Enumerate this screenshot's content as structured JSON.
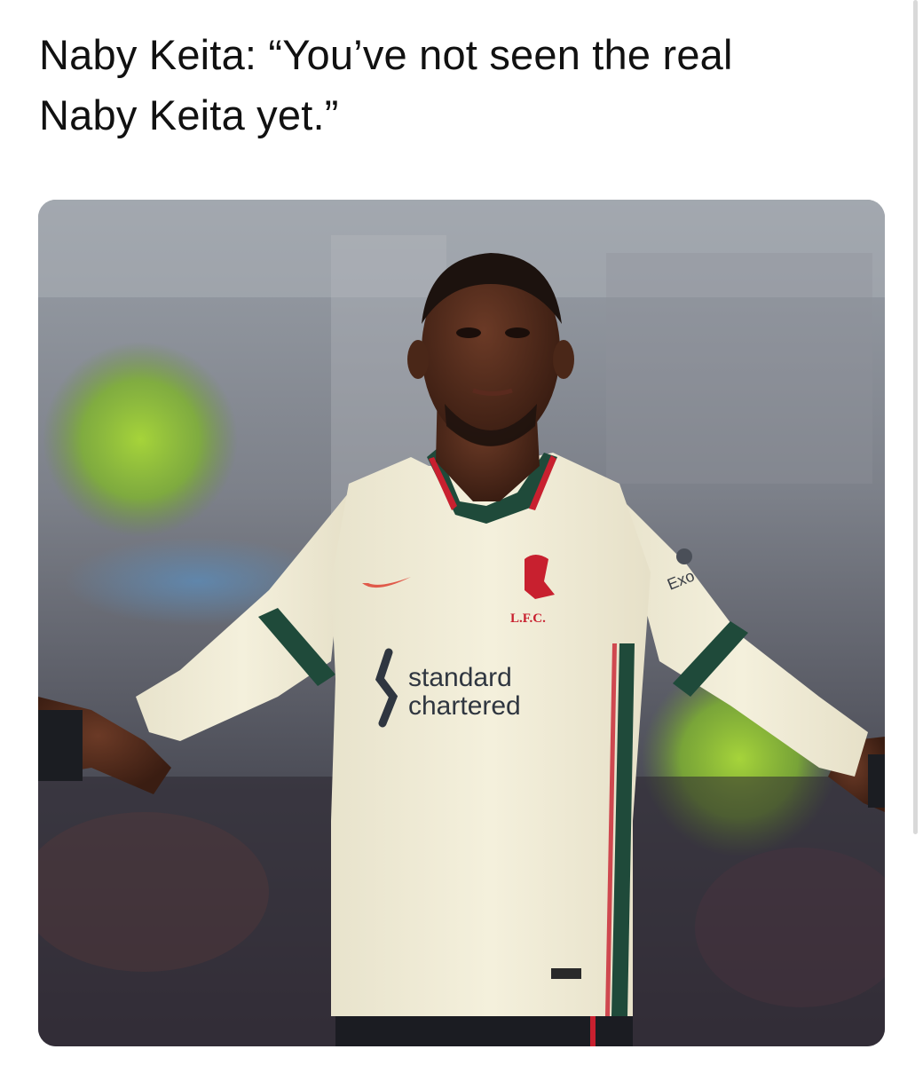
{
  "post": {
    "text_line_1": "Naby Keita: “You’ve not seen the real",
    "text_line_2": "Naby Keita yet.”"
  },
  "media": {
    "description": "Photo of a footballer in a cream Liverpool away shirt with arms outstretched",
    "shirt": {
      "sponsor_line_1": "standard",
      "sponsor_line_2": "chartered",
      "crest_text": "L.F.C.",
      "sleeve_text": "Exo"
    }
  },
  "colors": {
    "text": "#111111",
    "background": "#ffffff",
    "shirt_cream": "#f1ecd6",
    "shirt_trim_green": "#1f4a3a",
    "crest_red": "#c8202f"
  }
}
